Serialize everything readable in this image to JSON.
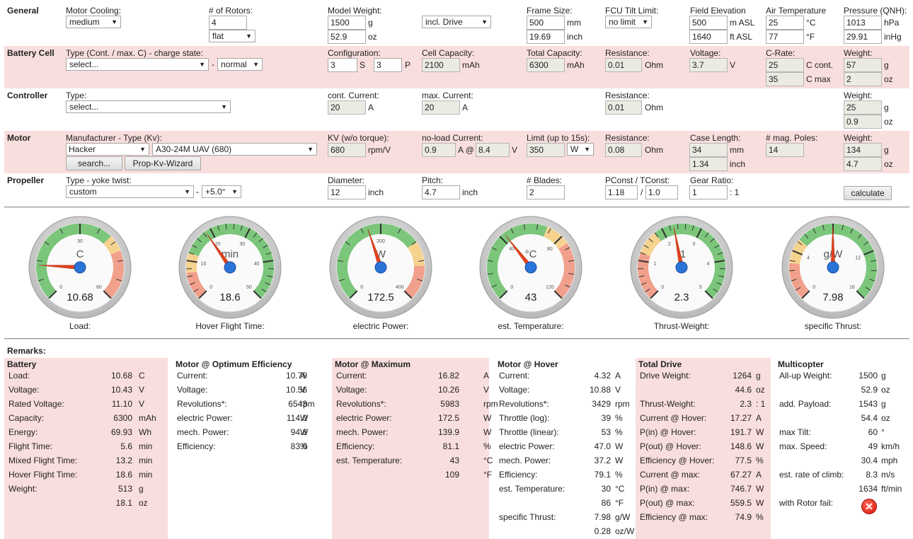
{
  "general": {
    "section": "General",
    "motor_cooling_label": "Motor Cooling:",
    "motor_cooling_value": "medium",
    "rotors_label": "# of Rotors:",
    "rotors_value": "4",
    "rotor_layout_value": "flat",
    "model_weight_label": "Model Weight:",
    "model_weight_g": "1500",
    "model_weight_oz": "52.9",
    "weight_mode_value": "incl. Drive",
    "frame_size_label": "Frame Size:",
    "frame_size_mm": "500",
    "frame_size_inch": "19.69",
    "fcu_tilt_label": "FCU Tilt Limit:",
    "fcu_tilt_value": "no limit",
    "field_elev_label": "Field Elevation",
    "field_elev_m": "500",
    "field_elev_ft": "1640",
    "air_temp_label": "Air Temperature",
    "air_temp_c": "25",
    "air_temp_f": "77",
    "pressure_label": "Pressure (QNH):",
    "pressure_hpa": "1013",
    "pressure_inhg": "29.91",
    "units": {
      "g": "g",
      "oz": "oz",
      "mm": "mm",
      "inch": "inch",
      "m_asl": "m ASL",
      "ft_asl": "ft ASL",
      "c": "°C",
      "f": "°F",
      "hpa": "hPa",
      "inhg": "inHg"
    }
  },
  "battery": {
    "section": "Battery Cell",
    "type_label": "Type (Cont. / max. C) - charge state:",
    "type_value": "select...",
    "dash": "-",
    "charge_value": "normal",
    "config_label": "Configuration:",
    "config_s": "3",
    "config_s_unit": "S",
    "config_p": "3",
    "config_p_unit": "P",
    "cell_cap_label": "Cell Capacity:",
    "cell_cap_value": "2100",
    "cell_cap_unit": "mAh",
    "total_cap_label": "Total Capacity:",
    "total_cap_value": "6300",
    "total_cap_unit": "mAh",
    "resistance_label": "Resistance:",
    "resistance_value": "0.01",
    "resistance_unit": "Ohm",
    "voltage_label": "Voltage:",
    "voltage_value": "3.7",
    "voltage_unit": "V",
    "crate_label": "C-Rate:",
    "crate_cont": "25",
    "crate_cont_unit": "C cont.",
    "crate_max": "35",
    "crate_max_unit": "C max",
    "weight_label": "Weight:",
    "weight_g": "57",
    "weight_oz": "2"
  },
  "controller": {
    "section": "Controller",
    "type_label": "Type:",
    "type_value": "select...",
    "cont_current_label": "cont. Current:",
    "cont_current_value": "20",
    "max_current_label": "max. Current:",
    "max_current_value": "20",
    "amp_unit": "A",
    "resistance_label": "Resistance:",
    "resistance_value": "0.01",
    "resistance_unit": "Ohm",
    "weight_label": "Weight:",
    "weight_g": "25",
    "weight_oz": "0.9"
  },
  "motor": {
    "section": "Motor",
    "manufacturer_label": "Manufacturer - Type (Kv):",
    "manufacturer_value": "Hacker",
    "type_value": "A30-24M UAV (680)",
    "search_button": "search...",
    "wizard_button": "Prop-Kv-Wizard",
    "kv_label": "KV (w/o torque):",
    "kv_value": "680",
    "kv_unit": "rpm/V",
    "noload_label": "no-load Current:",
    "noload_current": "0.9",
    "noload_at": "A @",
    "noload_voltage": "8.4",
    "noload_v_unit": "V",
    "limit_label": "Limit (up to 15s):",
    "limit_value": "350",
    "limit_unit_value": "W",
    "resistance_label": "Resistance:",
    "resistance_value": "0.08",
    "resistance_unit": "Ohm",
    "case_length_label": "Case Length:",
    "case_length_mm": "34",
    "case_length_inch": "1.34",
    "poles_label": "# mag. Poles:",
    "poles_value": "14",
    "weight_label": "Weight:",
    "weight_g": "134",
    "weight_oz": "4.7"
  },
  "propeller": {
    "section": "Propeller",
    "type_label": "Type - yoke twist:",
    "type_value": "custom",
    "dash": "-",
    "twist_value": "+5.0°",
    "diameter_label": "Diameter:",
    "diameter_value": "12",
    "pitch_label": "Pitch:",
    "pitch_value": "4.7",
    "inch_unit": "inch",
    "blades_label": "# Blades:",
    "blades_value": "2",
    "pconst_label": "PConst / TConst:",
    "pconst_value": "1.18",
    "slash": "/",
    "tconst_value": "1.0",
    "gear_label": "Gear Ratio:",
    "gear_value": "1",
    "gear_suffix": ": 1",
    "calculate_button": "calculate"
  },
  "gauges": [
    {
      "label": "Load:",
      "unit": "C",
      "value": "10.68",
      "min": 0,
      "max": 60,
      "reading": 10.68,
      "ticks": [
        "0",
        "30",
        "60"
      ],
      "zones": [
        [
          0,
          40,
          "#7bc67b"
        ],
        [
          40,
          45,
          "#f6d28f"
        ],
        [
          45,
          60,
          "#f1a08c"
        ]
      ]
    },
    {
      "label": "Hover Flight Time:",
      "unit": "min",
      "value": "18.6",
      "min": 0,
      "max": 50,
      "reading": 18.6,
      "ticks": [
        "0",
        "10",
        "20",
        "30",
        "40",
        "50"
      ],
      "zones": [
        [
          0,
          7,
          "#f1a08c"
        ],
        [
          7,
          12,
          "#f6d28f"
        ],
        [
          12,
          50,
          "#7bc67b"
        ]
      ]
    },
    {
      "label": "electric Power:",
      "unit": "W",
      "value": "172.5",
      "min": 0,
      "max": 400,
      "reading": 172.5,
      "ticks": [
        "0",
        "200",
        "400"
      ],
      "zones": [
        [
          0,
          280,
          "#7bc67b"
        ],
        [
          280,
          330,
          "#f6d28f"
        ],
        [
          330,
          400,
          "#f1a08c"
        ]
      ]
    },
    {
      "label": "est. Temperature:",
      "unit": "°C",
      "value": "43",
      "min": 0,
      "max": 120,
      "reading": 43,
      "ticks": [
        "0",
        "40",
        "80",
        "120"
      ],
      "zones": [
        [
          0,
          70,
          "#7bc67b"
        ],
        [
          70,
          85,
          "#f6d28f"
        ],
        [
          85,
          120,
          "#f1a08c"
        ]
      ]
    },
    {
      "label": "Thrust-Weight:",
      "unit": ":1",
      "value": "2.3",
      "min": 0,
      "max": 5,
      "reading": 2.3,
      "ticks": [
        "0",
        "1",
        "2",
        "3",
        "4",
        "5"
      ],
      "zones": [
        [
          0,
          1.2,
          "#f1a08c"
        ],
        [
          1.2,
          1.8,
          "#f6d28f"
        ],
        [
          1.8,
          5,
          "#7bc67b"
        ]
      ]
    },
    {
      "label": "specific Thrust:",
      "unit": "g/W",
      "value": "7.98",
      "min": 0,
      "max": 16,
      "reading": 7.98,
      "ticks": [
        "0",
        "4",
        "8",
        "12",
        "16"
      ],
      "zones": [
        [
          0,
          3,
          "#f1a08c"
        ],
        [
          3,
          5,
          "#f6d28f"
        ],
        [
          5,
          16,
          "#7bc67b"
        ]
      ]
    }
  ],
  "remarks": {
    "title": "Remarks:",
    "battery": {
      "title": "Battery",
      "rows": [
        {
          "k": "Load:",
          "v": "10.68",
          "u": "C"
        },
        {
          "k": "Voltage:",
          "v": "10.43",
          "u": "V"
        },
        {
          "k": "Rated Voltage:",
          "v": "11.10",
          "u": "V"
        },
        {
          "k": "Capacity:",
          "v": "6300",
          "u": "mAh"
        },
        {
          "k": "Energy:",
          "v": "69.93",
          "u": "Wh"
        },
        {
          "k": "Flight Time:",
          "v": "5.6",
          "u": "min"
        },
        {
          "k": "Mixed Flight Time:",
          "v": "13.2",
          "u": "min"
        },
        {
          "k": "Hover Flight Time:",
          "v": "18.6",
          "u": "min"
        },
        {
          "k": "Weight:",
          "v": "513",
          "u": "g"
        },
        {
          "k": "",
          "v": "18.1",
          "u": "oz"
        }
      ]
    },
    "optimum": {
      "title": "Motor @ Optimum Efficiency",
      "rows": [
        {
          "k": "Current:",
          "v": "10.79",
          "u": "A"
        },
        {
          "k": "Voltage:",
          "v": "10.56",
          "u": "V"
        },
        {
          "k": "Revolutions*:",
          "v": "6543",
          "u": "rpm"
        },
        {
          "k": "electric Power:",
          "v": "114.0",
          "u": "W"
        },
        {
          "k": "mech. Power:",
          "v": "94.6",
          "u": "W"
        },
        {
          "k": "Efficiency:",
          "v": "83.0",
          "u": "%"
        }
      ]
    },
    "maximum": {
      "title": "Motor @ Maximum",
      "rows": [
        {
          "k": "Current:",
          "v": "16.82",
          "u": "A"
        },
        {
          "k": "Voltage:",
          "v": "10.26",
          "u": "V"
        },
        {
          "k": "Revolutions*:",
          "v": "5983",
          "u": "rpm"
        },
        {
          "k": "electric Power:",
          "v": "172.5",
          "u": "W"
        },
        {
          "k": "mech. Power:",
          "v": "139.9",
          "u": "W"
        },
        {
          "k": "Efficiency:",
          "v": "81.1",
          "u": "%"
        },
        {
          "k": "est. Temperature:",
          "v": "43",
          "u": "°C"
        },
        {
          "k": "",
          "v": "109",
          "u": "°F"
        }
      ]
    },
    "hover": {
      "title": "Motor @ Hover",
      "rows": [
        {
          "k": "Current:",
          "v": "4.32",
          "u": "A"
        },
        {
          "k": "Voltage:",
          "v": "10.88",
          "u": "V"
        },
        {
          "k": "Revolutions*:",
          "v": "3429",
          "u": "rpm"
        },
        {
          "k": "Throttle (log):",
          "v": "39",
          "u": "%"
        },
        {
          "k": "Throttle (linear):",
          "v": "53",
          "u": "%"
        },
        {
          "k": "electric Power:",
          "v": "47.0",
          "u": "W"
        },
        {
          "k": "mech. Power:",
          "v": "37.2",
          "u": "W"
        },
        {
          "k": "Efficiency:",
          "v": "79.1",
          "u": "%"
        },
        {
          "k": "est. Temperature:",
          "v": "30",
          "u": "°C"
        },
        {
          "k": "",
          "v": "86",
          "u": "°F"
        },
        {
          "k": "specific Thrust:",
          "v": "7.98",
          "u": "g/W"
        },
        {
          "k": "",
          "v": "0.28",
          "u": "oz/W"
        }
      ]
    },
    "total": {
      "title": "Total Drive",
      "rows": [
        {
          "k": "Drive Weight:",
          "v": "1264",
          "u": "g"
        },
        {
          "k": "",
          "v": "44.6",
          "u": "oz"
        },
        {
          "k": "Thrust-Weight:",
          "v": "2.3",
          "u": ": 1"
        },
        {
          "k": "Current @ Hover:",
          "v": "17.27",
          "u": "A"
        },
        {
          "k": "P(in) @ Hover:",
          "v": "191.7",
          "u": "W"
        },
        {
          "k": "P(out) @ Hover:",
          "v": "148.6",
          "u": "W"
        },
        {
          "k": "Efficiency @ Hover:",
          "v": "77.5",
          "u": "%"
        },
        {
          "k": "Current @ max:",
          "v": "67.27",
          "u": "A"
        },
        {
          "k": "P(in) @ max:",
          "v": "746.7",
          "u": "W"
        },
        {
          "k": "P(out) @ max:",
          "v": "559.5",
          "u": "W"
        },
        {
          "k": "Efficiency @ max:",
          "v": "74.9",
          "u": "%"
        }
      ]
    },
    "multicopter": {
      "title": "Multicopter",
      "rows": [
        {
          "k": "All-up Weight:",
          "v": "1500",
          "u": "g"
        },
        {
          "k": "",
          "v": "52.9",
          "u": "oz"
        },
        {
          "k": "add. Payload:",
          "v": "1543",
          "u": "g"
        },
        {
          "k": "",
          "v": "54.4",
          "u": "oz"
        },
        {
          "k": "max Tilt:",
          "v": "60",
          "u": "°"
        },
        {
          "k": "max. Speed:",
          "v": "49",
          "u": "km/h"
        },
        {
          "k": "",
          "v": "30.4",
          "u": "mph"
        },
        {
          "k": "est. rate of climb:",
          "v": "8.3",
          "u": "m/s"
        },
        {
          "k": "",
          "v": "1634",
          "u": "ft/min"
        },
        {
          "k": "with Rotor fail:",
          "v": "",
          "u": ""
        }
      ],
      "rotor_fail_icon": "red-x-circle-icon"
    }
  }
}
